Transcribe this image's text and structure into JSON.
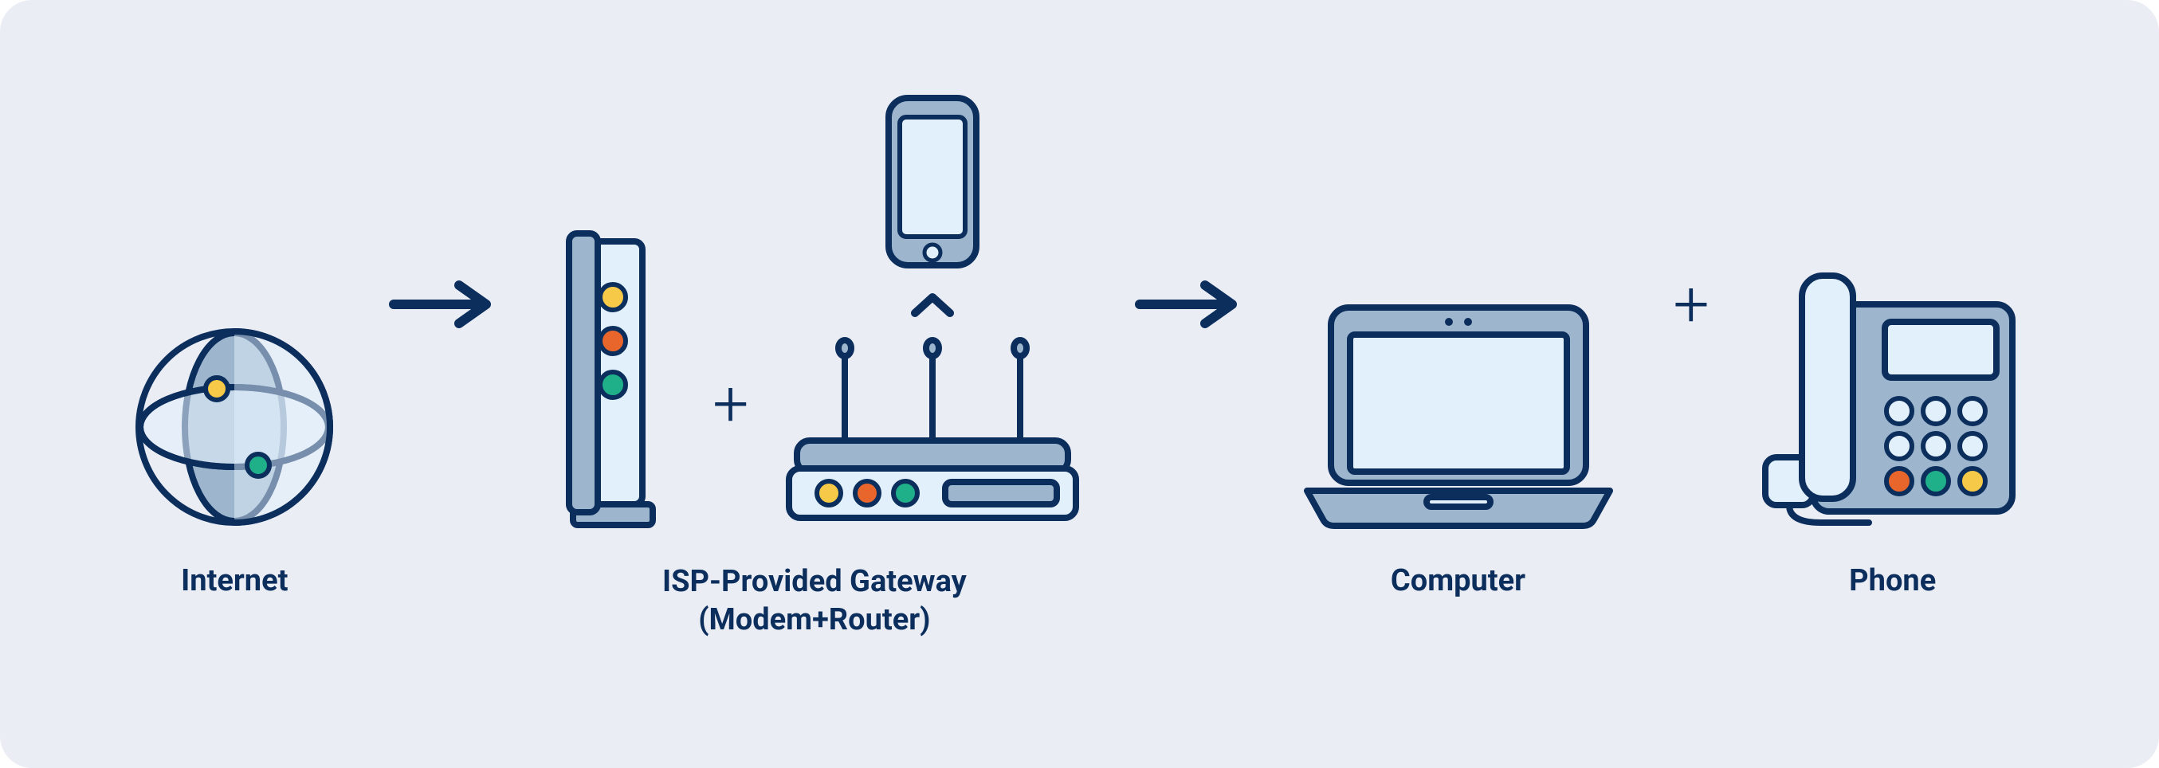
{
  "diagram": {
    "nodes": {
      "internet": {
        "label": "Internet"
      },
      "gateway": {
        "label": "ISP-Provided Gateway\n(Modem+Router)"
      },
      "computer": {
        "label": "Computer"
      },
      "phone": {
        "label": "Phone"
      }
    },
    "connectors": {
      "arrow1": "arrow",
      "plus1": "+",
      "arrow2": "arrow",
      "plus2": "+"
    },
    "colors": {
      "stroke": "#0c2e5c",
      "light_fill": "#e2f0fb",
      "panel_fill": "#9db6cd",
      "yellow": "#f7c948",
      "orange": "#e8662c",
      "green": "#1fb08a"
    }
  }
}
